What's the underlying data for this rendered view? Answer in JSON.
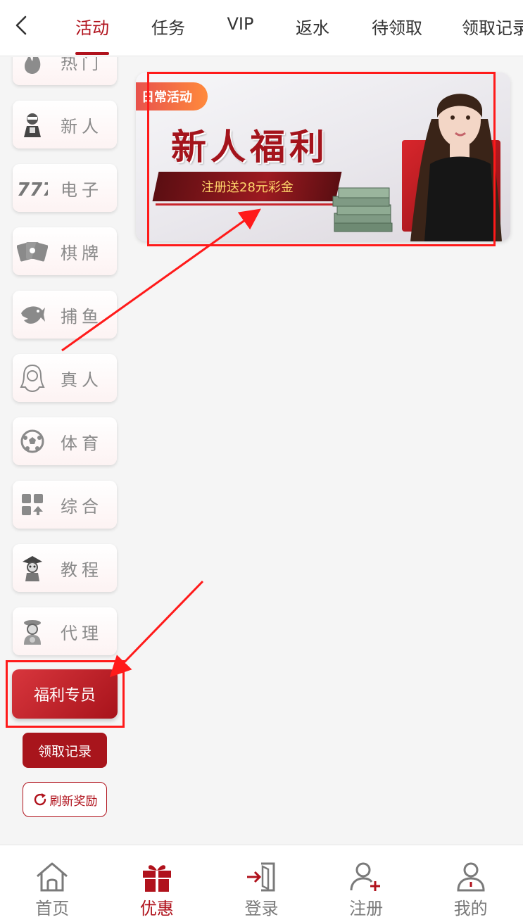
{
  "header": {
    "back_icon": "chevron-left-icon",
    "tabs": [
      {
        "label": "活动",
        "active": true
      },
      {
        "label": "任务",
        "active": false
      },
      {
        "label": "VIP",
        "active": false
      },
      {
        "label": "返水",
        "active": false
      },
      {
        "label": "待领取",
        "active": false
      },
      {
        "label": "领取记录",
        "active": false
      }
    ]
  },
  "sidebar": {
    "categories": [
      {
        "label": "热门",
        "icon": "fire-icon"
      },
      {
        "label": "新人",
        "icon": "newbie-icon"
      },
      {
        "label": "电子",
        "icon": "slot-777-icon"
      },
      {
        "label": "棋牌",
        "icon": "cards-icon"
      },
      {
        "label": "捕鱼",
        "icon": "shark-icon"
      },
      {
        "label": "真人",
        "icon": "dealer-icon"
      },
      {
        "label": "体育",
        "icon": "soccer-ball-icon"
      },
      {
        "label": "综合",
        "icon": "grid-icon"
      },
      {
        "label": "教程",
        "icon": "tutorial-icon"
      },
      {
        "label": "代理",
        "icon": "agent-icon"
      }
    ],
    "welfare_button": "福利专员",
    "record_button": "领取记录",
    "refresh_button": "刷新奖励"
  },
  "banner": {
    "tag": "日常活动",
    "title": "新人福利",
    "subtitle": "注册送28元彩金"
  },
  "bottom_nav": [
    {
      "label": "首页",
      "icon": "home-icon",
      "active": false
    },
    {
      "label": "优惠",
      "icon": "gift-icon",
      "active": true
    },
    {
      "label": "登录",
      "icon": "login-icon",
      "active": false
    },
    {
      "label": "注册",
      "icon": "register-icon",
      "active": false
    },
    {
      "label": "我的",
      "icon": "profile-icon",
      "active": false
    }
  ],
  "colors": {
    "accent": "#b0121c",
    "annotation": "#ff1a1a"
  }
}
